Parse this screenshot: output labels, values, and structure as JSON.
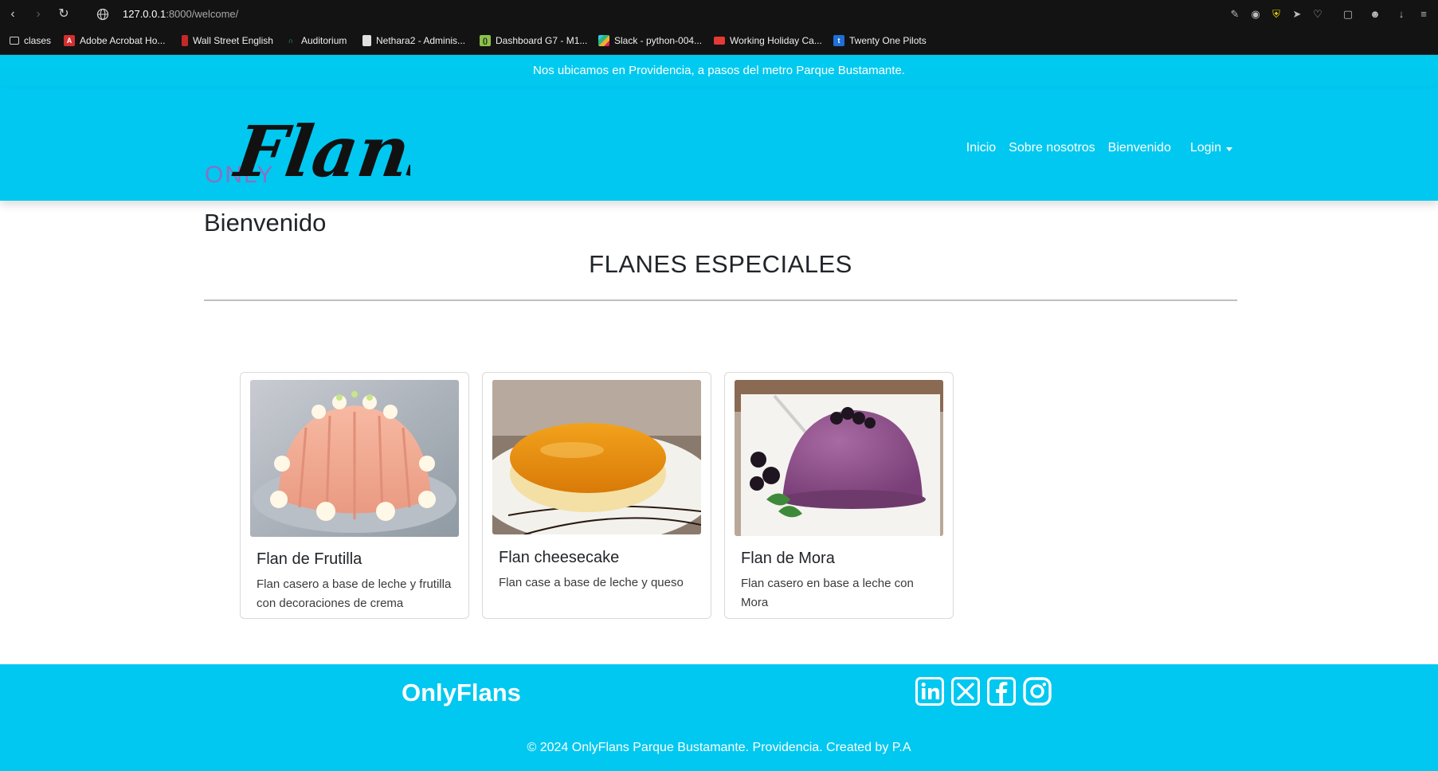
{
  "browser": {
    "url_host": "127.0.0.1",
    "url_path": ":8000/welcome/",
    "bookmarks": [
      {
        "label": "clases",
        "icon": "folder-icon",
        "color": "#cfcfcf"
      },
      {
        "label": "Adobe Acrobat Ho...",
        "icon": "acrobat-icon",
        "color": "#d32f2f"
      },
      {
        "label": "Wall Street English",
        "icon": "wse-icon",
        "color": "#c62828"
      },
      {
        "label": "Auditorium",
        "icon": "auditorium-icon",
        "color": "#2bb3a0"
      },
      {
        "label": "Nethara2 - Adminis...",
        "icon": "document-icon",
        "color": "#e0e0e0"
      },
      {
        "label": "Dashboard G7 - M1...",
        "icon": "dashboard-icon",
        "color": "#8bc34a"
      },
      {
        "label": "Slack - python-004...",
        "icon": "slack-icon",
        "color": "#e01e5a"
      },
      {
        "label": "Working Holiday Ca...",
        "icon": "whc-icon",
        "color": "#e53935"
      },
      {
        "label": "Twenty One Pilots",
        "icon": "tumblr-icon",
        "color": "#1e6fd9"
      }
    ]
  },
  "site": {
    "announcement": "Nos ubicamos en Providencia, a pasos del metro Parque Bustamante.",
    "logo": {
      "small": "ONLY",
      "script": "Flans"
    },
    "nav": {
      "inicio": "Inicio",
      "sobre": "Sobre nosotros",
      "bienvenido": "Bienvenido",
      "login": "Login"
    },
    "page_title": "Bienvenido",
    "section_title": "FLANES ESPECIALES",
    "cards": [
      {
        "title": "Flan de Frutilla",
        "text": "Flan casero a base de leche y frutilla con decoraciones de crema"
      },
      {
        "title": "Flan cheesecake",
        "text": "Flan case a base de leche y queso"
      },
      {
        "title": "Flan de Mora",
        "text": "Flan casero en base a leche con Mora"
      }
    ],
    "footer": {
      "brand": "OnlyFlans",
      "social": [
        "linkedin-icon",
        "x-twitter-icon",
        "facebook-icon",
        "instagram-icon"
      ],
      "copyright": "© 2024 OnlyFlans Parque Bustamante. Providencia. Created by P.A"
    },
    "colors": {
      "brand": "#00c8f0",
      "logo_small": "#8b6fc2",
      "ink": "#212529"
    }
  }
}
